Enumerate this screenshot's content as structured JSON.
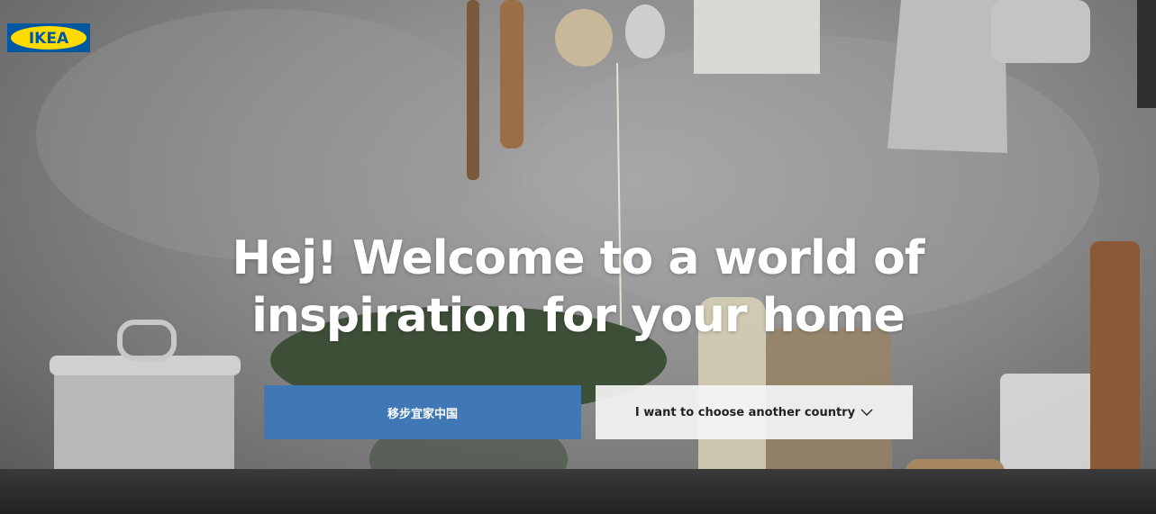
{
  "brand": {
    "logo_text": "IKEA",
    "registered_mark": "®",
    "colors": {
      "blue": "#0058a3",
      "yellow": "#ffdb00"
    }
  },
  "hero": {
    "title_line1": "Hej! Welcome to a world of",
    "title_line2": "inspiration for your home"
  },
  "actions": {
    "primary_label": "移步宜家中国",
    "secondary_label": "I want to choose another country",
    "secondary_icon": "chevron-down-icon",
    "primary_color": "#3f78b5"
  }
}
